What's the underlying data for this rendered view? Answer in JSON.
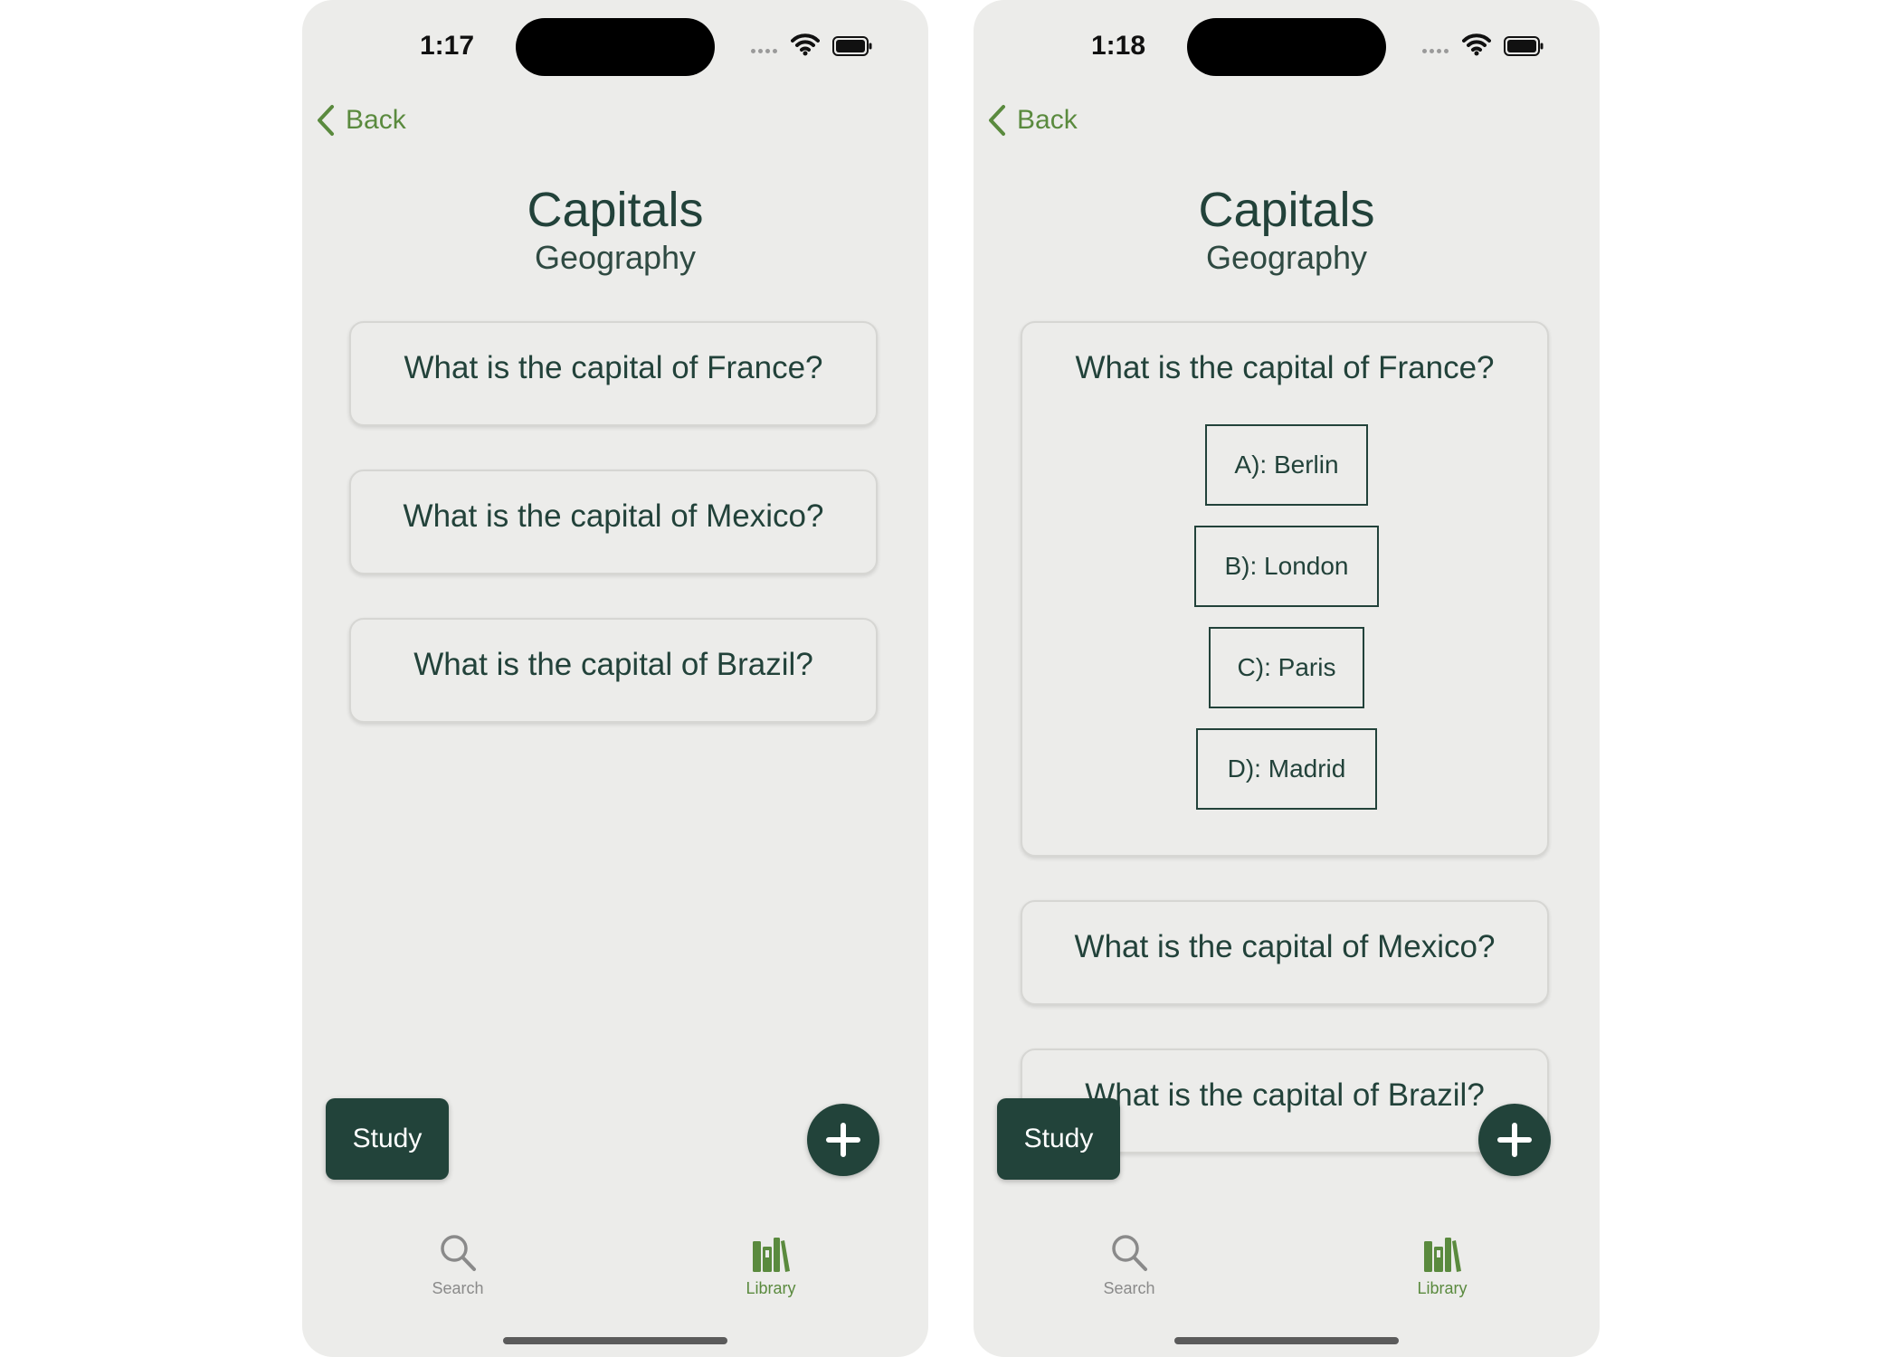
{
  "colors": {
    "accent_green": "#5a8a3e",
    "dark_green": "#22433a",
    "background": "#ececea"
  },
  "screens": [
    {
      "status_time": "1:17",
      "back_label": "Back",
      "title": "Capitals",
      "subtitle": "Geography",
      "questions": [
        {
          "text": "What is the capital of France?"
        },
        {
          "text": "What is the capital of Mexico?"
        },
        {
          "text": "What is the capital of Brazil?"
        }
      ],
      "study_label": "Study",
      "add_icon": "plus-icon",
      "tabs": [
        {
          "label": "Search",
          "icon": "search-icon",
          "selected": false
        },
        {
          "label": "Library",
          "icon": "library-icon",
          "selected": true
        }
      ]
    },
    {
      "status_time": "1:18",
      "back_label": "Back",
      "title": "Capitals",
      "subtitle": "Geography",
      "questions": [
        {
          "text": "What is the capital of France?",
          "expanded": true,
          "options": [
            "A): Berlin",
            "B): London",
            "C): Paris",
            "D): Madrid"
          ]
        },
        {
          "text": "What is the capital of Mexico?"
        },
        {
          "text": "What is the capital of Brazil?"
        }
      ],
      "study_label": "Study",
      "add_icon": "plus-icon",
      "tabs": [
        {
          "label": "Search",
          "icon": "search-icon",
          "selected": false
        },
        {
          "label": "Library",
          "icon": "library-icon",
          "selected": true
        }
      ]
    }
  ]
}
